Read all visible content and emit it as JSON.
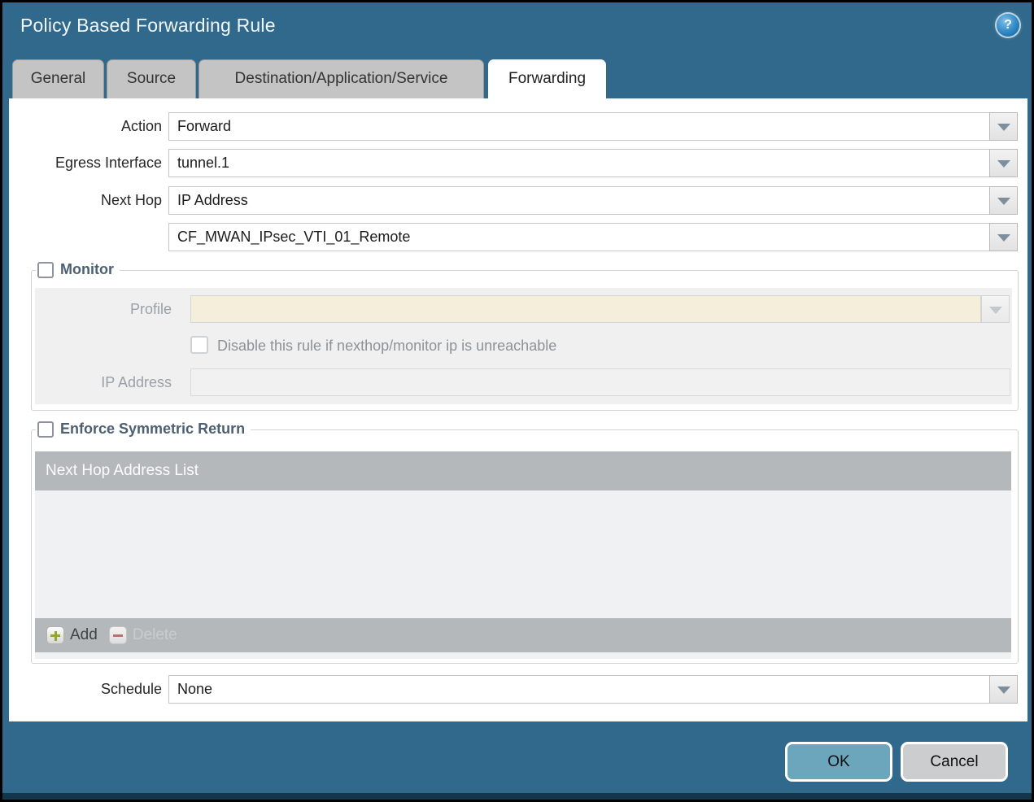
{
  "title": "Policy Based Forwarding Rule",
  "help_glyph": "?",
  "tabs": {
    "general": "General",
    "source": "Source",
    "destination": "Destination/Application/Service",
    "forwarding": "Forwarding"
  },
  "fields": {
    "action_label": "Action",
    "action_value": "Forward",
    "egress_label": "Egress Interface",
    "egress_value": "tunnel.1",
    "nexthop_label": "Next Hop",
    "nexthop_value": "IP Address",
    "nexthop_address_value": "CF_MWAN_IPsec_VTI_01_Remote",
    "schedule_label": "Schedule",
    "schedule_value": "None"
  },
  "monitor": {
    "label": "Monitor",
    "checked": false,
    "profile_label": "Profile",
    "profile_value": "",
    "disable_checkbox_label": "Disable this rule if nexthop/monitor ip is unreachable",
    "disable_checked": false,
    "ip_label": "IP Address",
    "ip_value": ""
  },
  "symmetric_return": {
    "label": "Enforce Symmetric Return",
    "checked": false,
    "table_header": "Next Hop Address List",
    "rows": [],
    "add_label": "Add",
    "delete_label": "Delete",
    "delete_enabled": false
  },
  "buttons": {
    "ok": "OK",
    "cancel": "Cancel"
  },
  "colors": {
    "titlebar": "#30698b",
    "active_tab": "#ffffff",
    "inactive_tab": "#c4c4c4",
    "ok_button": "#6ca6bd",
    "cancel_button": "#cbcdce",
    "disabled_field_beige": "#f5eeda",
    "table_header": "#b4b8bb",
    "legend_text": "#4c6073",
    "add_plus": "#93a433",
    "delete_minus": "#bb6f74"
  }
}
